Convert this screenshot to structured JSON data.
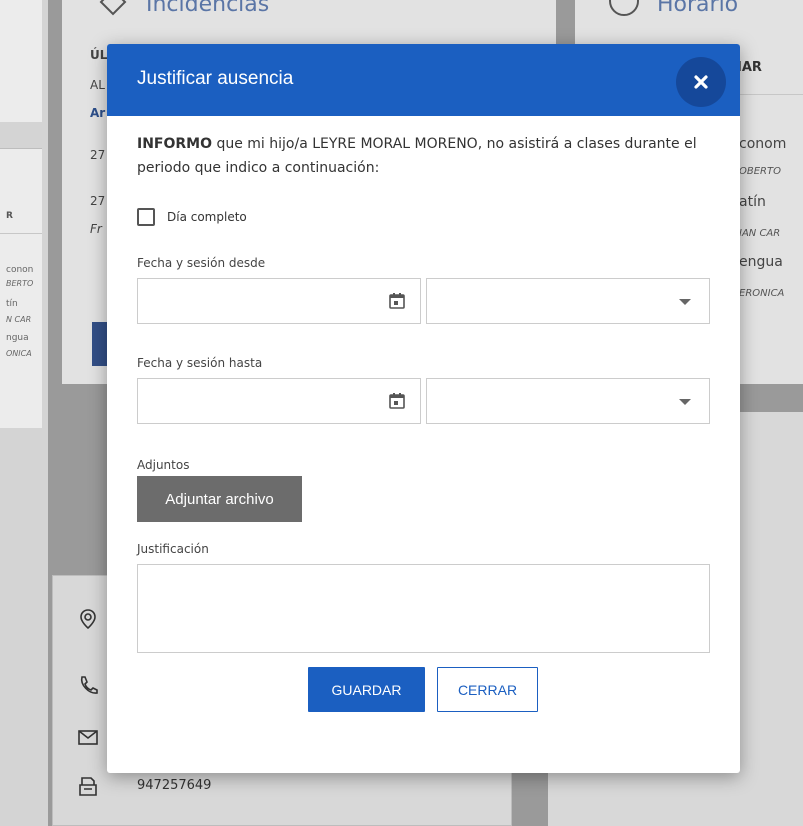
{
  "background": {
    "incidencias": {
      "title": "Incidencias",
      "lines": [
        "ÚL",
        "AL",
        "Ar",
        "27",
        "27",
        "Fr"
      ]
    },
    "horario": {
      "title": "Horario",
      "header": "IAR",
      "items": [
        "conom",
        "OBERTO",
        "atín",
        "IAN CAR",
        "engua",
        "ERONICA"
      ]
    },
    "small_panel": {
      "header": "R",
      "items": [
        "conon",
        "BERTO",
        "tín",
        "N CAR",
        "ngua",
        "ONICA"
      ]
    },
    "contact": {
      "fax": "947257649"
    }
  },
  "modal": {
    "title": "Justificar ausencia",
    "info_bold": "INFORMO",
    "info_text": " que mi hijo/a LEYRE MORAL MORENO, no asistirá a clases durante el periodo que indico a continuación:",
    "full_day_label": "Día completo",
    "from_label": "Fecha y sesión desde",
    "to_label": "Fecha y sesión hasta",
    "from_date": "",
    "from_session": "",
    "to_date": "",
    "to_session": "",
    "attachments_label": "Adjuntos",
    "attach_button": "Adjuntar archivo",
    "justification_label": "Justificación",
    "justification_value": "",
    "save_button": "GUARDAR",
    "close_button": "CERRAR"
  },
  "colors": {
    "primary": "#1b5fc1",
    "close_circle": "#15489a",
    "attach_button": "#6c6c6c"
  }
}
